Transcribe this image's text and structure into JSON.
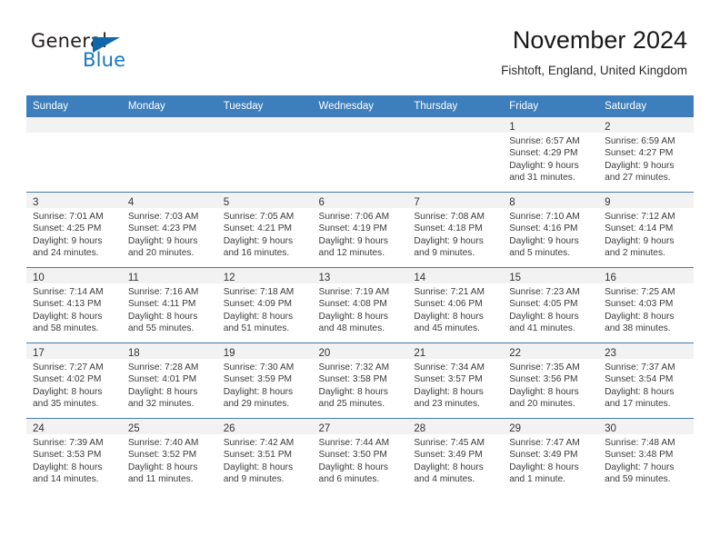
{
  "brand": {
    "name_part1": "General",
    "name_part2": "Blue",
    "accent_color": "#1066ab",
    "text_color": "#231f20",
    "triangle_icon": "triangle-icon"
  },
  "header": {
    "title": "November 2024",
    "subtitle": "Fishtoft, England, United Kingdom",
    "header_bg_color": "#3d7ebd",
    "daynum_band_color": "#f2f2f2"
  },
  "weekday_headers": [
    "Sunday",
    "Monday",
    "Tuesday",
    "Wednesday",
    "Thursday",
    "Friday",
    "Saturday"
  ],
  "labels": {
    "sunrise": "Sunrise:",
    "sunset": "Sunset:",
    "daylight": "Daylight:"
  },
  "weeks": [
    [
      {
        "day": "",
        "lines": []
      },
      {
        "day": "",
        "lines": []
      },
      {
        "day": "",
        "lines": []
      },
      {
        "day": "",
        "lines": []
      },
      {
        "day": "",
        "lines": []
      },
      {
        "day": "1",
        "lines": [
          "Sunrise: 6:57 AM",
          "Sunset: 4:29 PM",
          "Daylight: 9 hours",
          "and 31 minutes."
        ]
      },
      {
        "day": "2",
        "lines": [
          "Sunrise: 6:59 AM",
          "Sunset: 4:27 PM",
          "Daylight: 9 hours",
          "and 27 minutes."
        ]
      }
    ],
    [
      {
        "day": "3",
        "lines": [
          "Sunrise: 7:01 AM",
          "Sunset: 4:25 PM",
          "Daylight: 9 hours",
          "and 24 minutes."
        ]
      },
      {
        "day": "4",
        "lines": [
          "Sunrise: 7:03 AM",
          "Sunset: 4:23 PM",
          "Daylight: 9 hours",
          "and 20 minutes."
        ]
      },
      {
        "day": "5",
        "lines": [
          "Sunrise: 7:05 AM",
          "Sunset: 4:21 PM",
          "Daylight: 9 hours",
          "and 16 minutes."
        ]
      },
      {
        "day": "6",
        "lines": [
          "Sunrise: 7:06 AM",
          "Sunset: 4:19 PM",
          "Daylight: 9 hours",
          "and 12 minutes."
        ]
      },
      {
        "day": "7",
        "lines": [
          "Sunrise: 7:08 AM",
          "Sunset: 4:18 PM",
          "Daylight: 9 hours",
          "and 9 minutes."
        ]
      },
      {
        "day": "8",
        "lines": [
          "Sunrise: 7:10 AM",
          "Sunset: 4:16 PM",
          "Daylight: 9 hours",
          "and 5 minutes."
        ]
      },
      {
        "day": "9",
        "lines": [
          "Sunrise: 7:12 AM",
          "Sunset: 4:14 PM",
          "Daylight: 9 hours",
          "and 2 minutes."
        ]
      }
    ],
    [
      {
        "day": "10",
        "lines": [
          "Sunrise: 7:14 AM",
          "Sunset: 4:13 PM",
          "Daylight: 8 hours",
          "and 58 minutes."
        ]
      },
      {
        "day": "11",
        "lines": [
          "Sunrise: 7:16 AM",
          "Sunset: 4:11 PM",
          "Daylight: 8 hours",
          "and 55 minutes."
        ]
      },
      {
        "day": "12",
        "lines": [
          "Sunrise: 7:18 AM",
          "Sunset: 4:09 PM",
          "Daylight: 8 hours",
          "and 51 minutes."
        ]
      },
      {
        "day": "13",
        "lines": [
          "Sunrise: 7:19 AM",
          "Sunset: 4:08 PM",
          "Daylight: 8 hours",
          "and 48 minutes."
        ]
      },
      {
        "day": "14",
        "lines": [
          "Sunrise: 7:21 AM",
          "Sunset: 4:06 PM",
          "Daylight: 8 hours",
          "and 45 minutes."
        ]
      },
      {
        "day": "15",
        "lines": [
          "Sunrise: 7:23 AM",
          "Sunset: 4:05 PM",
          "Daylight: 8 hours",
          "and 41 minutes."
        ]
      },
      {
        "day": "16",
        "lines": [
          "Sunrise: 7:25 AM",
          "Sunset: 4:03 PM",
          "Daylight: 8 hours",
          "and 38 minutes."
        ]
      }
    ],
    [
      {
        "day": "17",
        "lines": [
          "Sunrise: 7:27 AM",
          "Sunset: 4:02 PM",
          "Daylight: 8 hours",
          "and 35 minutes."
        ]
      },
      {
        "day": "18",
        "lines": [
          "Sunrise: 7:28 AM",
          "Sunset: 4:01 PM",
          "Daylight: 8 hours",
          "and 32 minutes."
        ]
      },
      {
        "day": "19",
        "lines": [
          "Sunrise: 7:30 AM",
          "Sunset: 3:59 PM",
          "Daylight: 8 hours",
          "and 29 minutes."
        ]
      },
      {
        "day": "20",
        "lines": [
          "Sunrise: 7:32 AM",
          "Sunset: 3:58 PM",
          "Daylight: 8 hours",
          "and 25 minutes."
        ]
      },
      {
        "day": "21",
        "lines": [
          "Sunrise: 7:34 AM",
          "Sunset: 3:57 PM",
          "Daylight: 8 hours",
          "and 23 minutes."
        ]
      },
      {
        "day": "22",
        "lines": [
          "Sunrise: 7:35 AM",
          "Sunset: 3:56 PM",
          "Daylight: 8 hours",
          "and 20 minutes."
        ]
      },
      {
        "day": "23",
        "lines": [
          "Sunrise: 7:37 AM",
          "Sunset: 3:54 PM",
          "Daylight: 8 hours",
          "and 17 minutes."
        ]
      }
    ],
    [
      {
        "day": "24",
        "lines": [
          "Sunrise: 7:39 AM",
          "Sunset: 3:53 PM",
          "Daylight: 8 hours",
          "and 14 minutes."
        ]
      },
      {
        "day": "25",
        "lines": [
          "Sunrise: 7:40 AM",
          "Sunset: 3:52 PM",
          "Daylight: 8 hours",
          "and 11 minutes."
        ]
      },
      {
        "day": "26",
        "lines": [
          "Sunrise: 7:42 AM",
          "Sunset: 3:51 PM",
          "Daylight: 8 hours",
          "and 9 minutes."
        ]
      },
      {
        "day": "27",
        "lines": [
          "Sunrise: 7:44 AM",
          "Sunset: 3:50 PM",
          "Daylight: 8 hours",
          "and 6 minutes."
        ]
      },
      {
        "day": "28",
        "lines": [
          "Sunrise: 7:45 AM",
          "Sunset: 3:49 PM",
          "Daylight: 8 hours",
          "and 4 minutes."
        ]
      },
      {
        "day": "29",
        "lines": [
          "Sunrise: 7:47 AM",
          "Sunset: 3:49 PM",
          "Daylight: 8 hours",
          "and 1 minute."
        ]
      },
      {
        "day": "30",
        "lines": [
          "Sunrise: 7:48 AM",
          "Sunset: 3:48 PM",
          "Daylight: 7 hours",
          "and 59 minutes."
        ]
      }
    ]
  ]
}
